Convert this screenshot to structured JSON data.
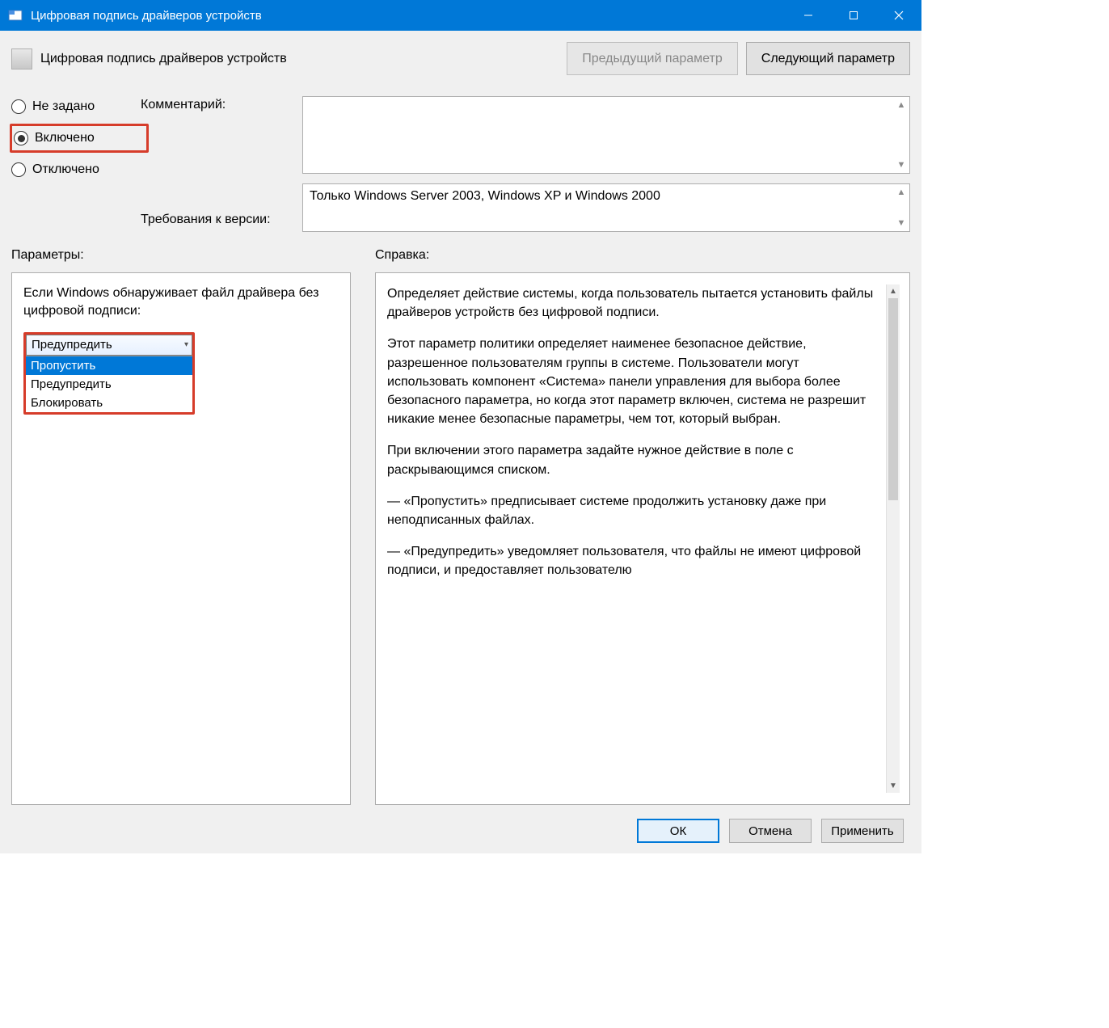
{
  "titlebar": {
    "title": "Цифровая подпись драйверов устройств"
  },
  "header": {
    "title": "Цифровая подпись драйверов устройств",
    "prev_button": "Предыдущий параметр",
    "next_button": "Следующий параметр"
  },
  "radios": {
    "not_configured": "Не задано",
    "enabled": "Включено",
    "disabled": "Отключено"
  },
  "labels": {
    "comment": "Комментарий:",
    "requirements": "Требования к версии:",
    "parameters_heading": "Параметры:",
    "help_heading": "Справка:"
  },
  "requirements_text": "Только Windows Server 2003, Windows XP и Windows 2000",
  "parameters": {
    "intro": "Если Windows обнаруживает файл драйвера без цифровой подписи:",
    "dropdown_value": "Предупредить",
    "options": [
      "Пропустить",
      "Предупредить",
      "Блокировать"
    ],
    "highlighted_option_index": 0
  },
  "help": {
    "p1": "Определяет действие системы, когда пользователь пытается установить файлы драйверов устройств без цифровой подписи.",
    "p2": "Этот параметр политики определяет наименее безопасное действие, разрешенное пользователям группы в системе. Пользователи могут использовать компонент «Система» панели управления для выбора более безопасного параметра, но когда этот параметр включен, система не разрешит никакие менее безопасные параметры, чем тот, который выбран.",
    "p3": "При включении этого параметра задайте нужное действие в поле с раскрывающимся списком.",
    "p4": "— «Пропустить» предписывает системе продолжить установку даже при неподписанных файлах.",
    "p5": "— «Предупредить» уведомляет пользователя, что файлы не имеют цифровой подписи, и предоставляет пользователю"
  },
  "footer": {
    "ok": "ОК",
    "cancel": "Отмена",
    "apply": "Применить"
  }
}
